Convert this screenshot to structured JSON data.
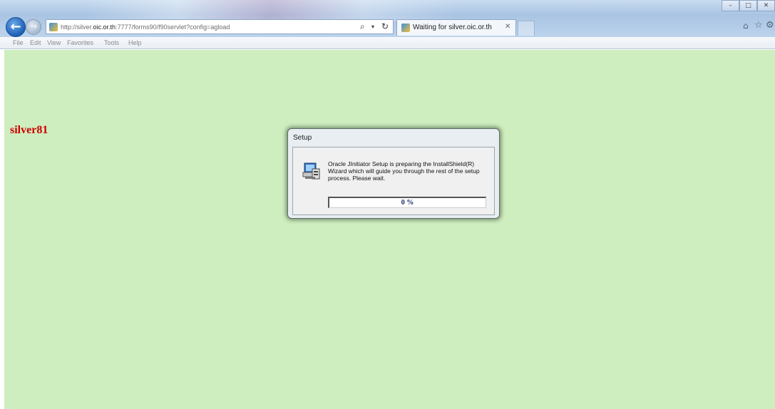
{
  "browser": {
    "url_prefix": "http://silver.",
    "url_domain": "oic.or.th",
    "url_rest": ":7777/forms90/f90servlet?config=agload",
    "tab_title": "Waiting for silver.oic.or.th",
    "menu": [
      "File",
      "Edit",
      "View",
      "Favorites",
      "Tools",
      "Help"
    ]
  },
  "page": {
    "site_name": "silver81"
  },
  "dialog": {
    "title": "Setup",
    "message": "Oracle JInitiator Setup is preparing the InstallShield(R) Wizard which will guide you through the rest of the setup process.  Please wait.",
    "progress_percent": 0,
    "progress_label": "0 %"
  },
  "colors": {
    "page_background": "#cfeebf",
    "site_name": "#cc0000",
    "progress_fill": "#1d3fa0"
  }
}
